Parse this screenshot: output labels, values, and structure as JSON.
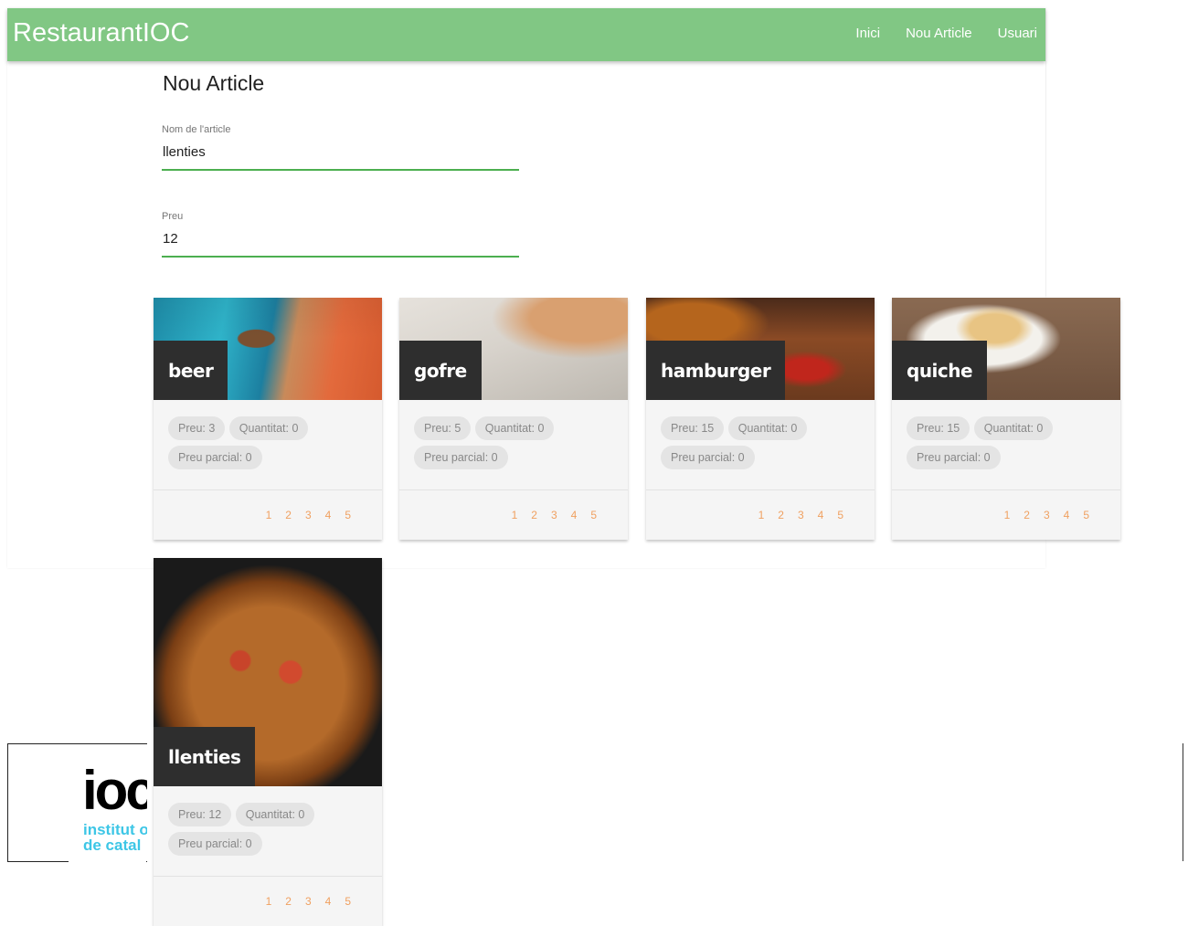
{
  "app": {
    "brand": "RestaurantIOC"
  },
  "nav": {
    "items": [
      "Inici",
      "Nou Article",
      "Usuari"
    ]
  },
  "form": {
    "title": "Nou Article",
    "name_label": "Nom de l'article",
    "name_value": "llenties",
    "price_label": "Preu",
    "price_value": "12"
  },
  "cards": [
    {
      "title": "beer",
      "preu": "Preu: 3",
      "quantitat": "Quantitat: 0",
      "parcial": "Preu parcial: 0",
      "pages": [
        "1",
        "2",
        "3",
        "4",
        "5"
      ]
    },
    {
      "title": "gofre",
      "preu": "Preu: 5",
      "quantitat": "Quantitat: 0",
      "parcial": "Preu parcial: 0",
      "pages": [
        "1",
        "2",
        "3",
        "4",
        "5"
      ]
    },
    {
      "title": "hamburger",
      "preu": "Preu: 15",
      "quantitat": "Quantitat: 0",
      "parcial": "Preu parcial: 0",
      "pages": [
        "1",
        "2",
        "3",
        "4",
        "5"
      ]
    },
    {
      "title": "quiche",
      "preu": "Preu: 15",
      "quantitat": "Quantitat: 0",
      "parcial": "Preu parcial: 0",
      "pages": [
        "1",
        "2",
        "3",
        "4",
        "5"
      ]
    },
    {
      "title": "llenties",
      "preu": "Preu: 12",
      "quantitat": "Quantitat: 0",
      "parcial": "Preu parcial: 0",
      "pages": [
        "1",
        "2",
        "3",
        "4",
        "5"
      ]
    }
  ],
  "logo": {
    "mark": "ioc",
    "line1": "institut o",
    "line2": "de catal"
  },
  "colors": {
    "navbar": "#81c784",
    "input_underline": "#4caf50",
    "page_link": "#f0a060",
    "logo_cyan": "#3dc6e6"
  }
}
